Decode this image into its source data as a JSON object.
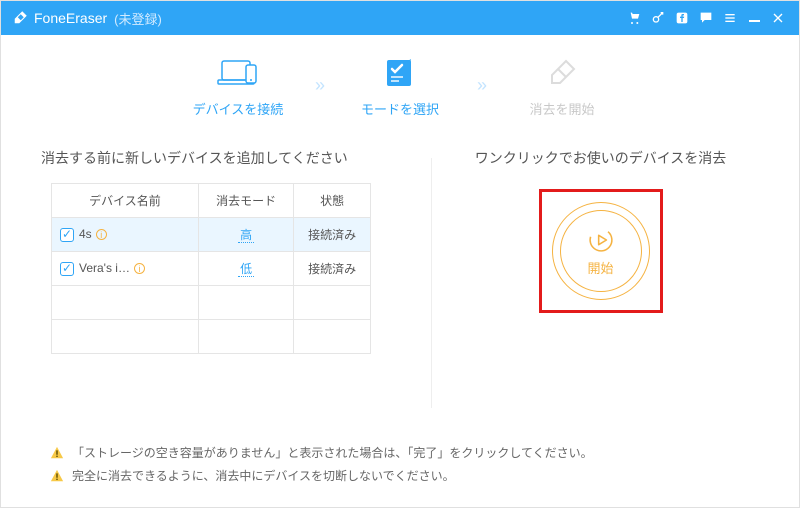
{
  "titlebar": {
    "app_name": "FoneEraser",
    "status": "(未登録)"
  },
  "steps": {
    "s1": {
      "label": "デバイスを接続"
    },
    "s2": {
      "label": "モードを選択"
    },
    "s3": {
      "label": "消去を開始"
    }
  },
  "left_panel": {
    "heading": "消去する前に新しいデバイスを追加してください",
    "cols": {
      "c1": "デバイス名前",
      "c2": "消去モード",
      "c3": "状態"
    },
    "rows": [
      {
        "name": "4s",
        "mode": "高",
        "status": "接続済み"
      },
      {
        "name": "Vera's i…",
        "mode": "低",
        "status": "接続済み"
      }
    ]
  },
  "right_panel": {
    "heading": "ワンクリックでお使いのデバイスを消去",
    "start_label": "開始"
  },
  "footer": {
    "w1": "「ストレージの空き容量がありません」と表示された場合は、「完了」をクリックしてください。",
    "w2": "完全に消去できるように、消去中にデバイスを切断しないでください。"
  }
}
